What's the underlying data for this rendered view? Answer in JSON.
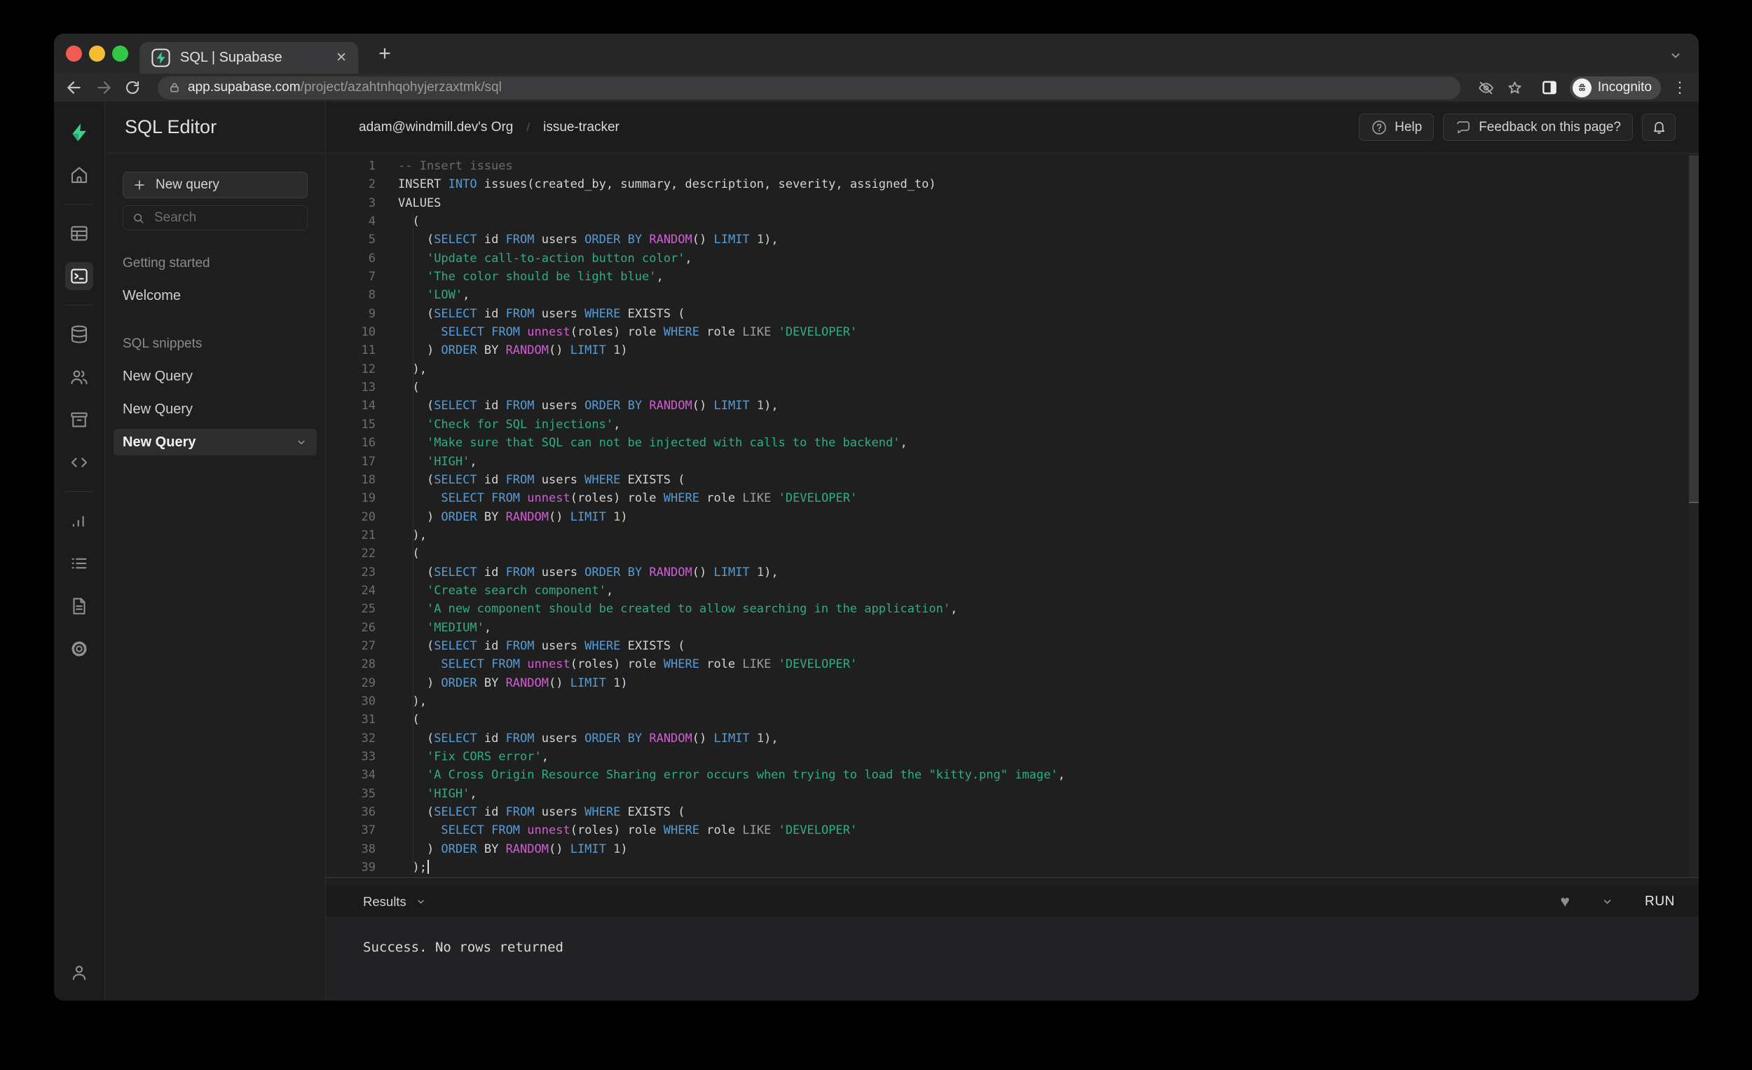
{
  "browser": {
    "tab_title": "SQL | Supabase",
    "url_host": "app.supabase.com",
    "url_path": "/project/azahtnhqohyjerzaxtmk/sql",
    "incognito_label": "Incognito"
  },
  "header": {
    "breadcrumb_org": "adam@windmill.dev's Org",
    "breadcrumb_sep": "/",
    "breadcrumb_project": "issue-tracker",
    "help_label": "Help",
    "feedback_label": "Feedback on this page?"
  },
  "sidebar": {
    "title": "SQL Editor",
    "new_query_button": "New query",
    "search_placeholder": "Search",
    "sections": [
      {
        "label": "Getting started",
        "items": [
          {
            "label": "Welcome"
          }
        ]
      },
      {
        "label": "SQL snippets",
        "items": [
          {
            "label": "New Query"
          },
          {
            "label": "New Query"
          },
          {
            "label": "New Query",
            "active": true
          }
        ]
      }
    ]
  },
  "results": {
    "label": "Results",
    "run_label": "RUN",
    "message": "Success. No rows returned"
  },
  "icons": {
    "plus": "+",
    "close": "✕",
    "kebab": "⋮",
    "heart": "♥",
    "question": "?"
  },
  "colors": {
    "accent_green": "#3ecf8e",
    "keyword_blue": "#569cd6",
    "function_magenta": "#d05ed0",
    "string_green": "#2fae7f",
    "number_green": "#b5cea8",
    "comment_gray": "#6b6b6b",
    "editor_bg": "#1f1f20",
    "chrome_bg": "#262627"
  },
  "editor": {
    "lines": [
      {
        "n": 1,
        "t": [
          [
            "c",
            "-- Insert issues"
          ]
        ]
      },
      {
        "n": 2,
        "t": [
          [
            "d",
            "INSERT "
          ],
          [
            "k",
            "INTO"
          ],
          [
            "d",
            " issues(created_by, summary, description, severity, assigned_to)"
          ]
        ]
      },
      {
        "n": 3,
        "t": [
          [
            "d",
            "VALUES"
          ]
        ]
      },
      {
        "n": 4,
        "t": [
          [
            "d",
            "  ("
          ]
        ]
      },
      {
        "n": 5,
        "t": [
          [
            "d",
            "    ("
          ],
          [
            "k",
            "SELECT"
          ],
          [
            "d",
            " id "
          ],
          [
            "k",
            "FROM"
          ],
          [
            "d",
            " users "
          ],
          [
            "k",
            "ORDER"
          ],
          [
            "d",
            " "
          ],
          [
            "k",
            "BY"
          ],
          [
            "d",
            " "
          ],
          [
            "f",
            "RANDOM"
          ],
          [
            "d",
            "() "
          ],
          [
            "k",
            "LIMIT"
          ],
          [
            "d",
            " "
          ],
          [
            "n",
            "1"
          ],
          [
            "d",
            "),"
          ]
        ]
      },
      {
        "n": 6,
        "t": [
          [
            "d",
            "    "
          ],
          [
            "s",
            "'Update call-to-action button color'"
          ],
          [
            "d",
            ","
          ]
        ]
      },
      {
        "n": 7,
        "t": [
          [
            "d",
            "    "
          ],
          [
            "s",
            "'The color should be light blue'"
          ],
          [
            "d",
            ","
          ]
        ]
      },
      {
        "n": 8,
        "t": [
          [
            "d",
            "    "
          ],
          [
            "s",
            "'LOW'"
          ],
          [
            "d",
            ","
          ]
        ]
      },
      {
        "n": 9,
        "t": [
          [
            "d",
            "    ("
          ],
          [
            "k",
            "SELECT"
          ],
          [
            "d",
            " id "
          ],
          [
            "k",
            "FROM"
          ],
          [
            "d",
            " users "
          ],
          [
            "k",
            "WHERE"
          ],
          [
            "d",
            " EXISTS ("
          ]
        ]
      },
      {
        "n": 10,
        "t": [
          [
            "d",
            "      "
          ],
          [
            "k",
            "SELECT"
          ],
          [
            "d",
            " "
          ],
          [
            "k",
            "FROM"
          ],
          [
            "d",
            " "
          ],
          [
            "f",
            "unnest"
          ],
          [
            "d",
            "(roles) role "
          ],
          [
            "k",
            "WHERE"
          ],
          [
            "d",
            " role "
          ],
          [
            "g",
            "LIKE"
          ],
          [
            "d",
            " "
          ],
          [
            "s",
            "'DEVELOPER'"
          ]
        ]
      },
      {
        "n": 11,
        "t": [
          [
            "d",
            "    ) "
          ],
          [
            "k",
            "ORDER"
          ],
          [
            "d",
            " BY "
          ],
          [
            "f",
            "RANDOM"
          ],
          [
            "d",
            "() "
          ],
          [
            "k",
            "LIMIT"
          ],
          [
            "d",
            " "
          ],
          [
            "n",
            "1"
          ],
          [
            "d",
            ")"
          ]
        ]
      },
      {
        "n": 12,
        "t": [
          [
            "d",
            "  ),"
          ]
        ]
      },
      {
        "n": 13,
        "t": [
          [
            "d",
            "  ("
          ]
        ]
      },
      {
        "n": 14,
        "t": [
          [
            "d",
            "    ("
          ],
          [
            "k",
            "SELECT"
          ],
          [
            "d",
            " id "
          ],
          [
            "k",
            "FROM"
          ],
          [
            "d",
            " users "
          ],
          [
            "k",
            "ORDER"
          ],
          [
            "d",
            " "
          ],
          [
            "k",
            "BY"
          ],
          [
            "d",
            " "
          ],
          [
            "f",
            "RANDOM"
          ],
          [
            "d",
            "() "
          ],
          [
            "k",
            "LIMIT"
          ],
          [
            "d",
            " "
          ],
          [
            "n",
            "1"
          ],
          [
            "d",
            "),"
          ]
        ]
      },
      {
        "n": 15,
        "t": [
          [
            "d",
            "    "
          ],
          [
            "s",
            "'Check for SQL injections'"
          ],
          [
            "d",
            ","
          ]
        ]
      },
      {
        "n": 16,
        "t": [
          [
            "d",
            "    "
          ],
          [
            "s",
            "'Make sure that SQL can not be injected with calls to the backend'"
          ],
          [
            "d",
            ","
          ]
        ]
      },
      {
        "n": 17,
        "t": [
          [
            "d",
            "    "
          ],
          [
            "s",
            "'HIGH'"
          ],
          [
            "d",
            ","
          ]
        ]
      },
      {
        "n": 18,
        "t": [
          [
            "d",
            "    ("
          ],
          [
            "k",
            "SELECT"
          ],
          [
            "d",
            " id "
          ],
          [
            "k",
            "FROM"
          ],
          [
            "d",
            " users "
          ],
          [
            "k",
            "WHERE"
          ],
          [
            "d",
            " EXISTS ("
          ]
        ]
      },
      {
        "n": 19,
        "t": [
          [
            "d",
            "      "
          ],
          [
            "k",
            "SELECT"
          ],
          [
            "d",
            " "
          ],
          [
            "k",
            "FROM"
          ],
          [
            "d",
            " "
          ],
          [
            "f",
            "unnest"
          ],
          [
            "d",
            "(roles) role "
          ],
          [
            "k",
            "WHERE"
          ],
          [
            "d",
            " role "
          ],
          [
            "g",
            "LIKE"
          ],
          [
            "d",
            " "
          ],
          [
            "s",
            "'DEVELOPER'"
          ]
        ]
      },
      {
        "n": 20,
        "t": [
          [
            "d",
            "    ) "
          ],
          [
            "k",
            "ORDER"
          ],
          [
            "d",
            " BY "
          ],
          [
            "f",
            "RANDOM"
          ],
          [
            "d",
            "() "
          ],
          [
            "k",
            "LIMIT"
          ],
          [
            "d",
            " "
          ],
          [
            "n",
            "1"
          ],
          [
            "d",
            ")"
          ]
        ]
      },
      {
        "n": 21,
        "t": [
          [
            "d",
            "  ),"
          ]
        ]
      },
      {
        "n": 22,
        "t": [
          [
            "d",
            "  ("
          ]
        ]
      },
      {
        "n": 23,
        "t": [
          [
            "d",
            "    ("
          ],
          [
            "k",
            "SELECT"
          ],
          [
            "d",
            " id "
          ],
          [
            "k",
            "FROM"
          ],
          [
            "d",
            " users "
          ],
          [
            "k",
            "ORDER"
          ],
          [
            "d",
            " "
          ],
          [
            "k",
            "BY"
          ],
          [
            "d",
            " "
          ],
          [
            "f",
            "RANDOM"
          ],
          [
            "d",
            "() "
          ],
          [
            "k",
            "LIMIT"
          ],
          [
            "d",
            " "
          ],
          [
            "n",
            "1"
          ],
          [
            "d",
            "),"
          ]
        ]
      },
      {
        "n": 24,
        "t": [
          [
            "d",
            "    "
          ],
          [
            "s",
            "'Create search component'"
          ],
          [
            "d",
            ","
          ]
        ]
      },
      {
        "n": 25,
        "t": [
          [
            "d",
            "    "
          ],
          [
            "s",
            "'A new component should be created to allow searching in the application'"
          ],
          [
            "d",
            ","
          ]
        ]
      },
      {
        "n": 26,
        "t": [
          [
            "d",
            "    "
          ],
          [
            "s",
            "'MEDIUM'"
          ],
          [
            "d",
            ","
          ]
        ]
      },
      {
        "n": 27,
        "t": [
          [
            "d",
            "    ("
          ],
          [
            "k",
            "SELECT"
          ],
          [
            "d",
            " id "
          ],
          [
            "k",
            "FROM"
          ],
          [
            "d",
            " users "
          ],
          [
            "k",
            "WHERE"
          ],
          [
            "d",
            " EXISTS ("
          ]
        ]
      },
      {
        "n": 28,
        "t": [
          [
            "d",
            "      "
          ],
          [
            "k",
            "SELECT"
          ],
          [
            "d",
            " "
          ],
          [
            "k",
            "FROM"
          ],
          [
            "d",
            " "
          ],
          [
            "f",
            "unnest"
          ],
          [
            "d",
            "(roles) role "
          ],
          [
            "k",
            "WHERE"
          ],
          [
            "d",
            " role "
          ],
          [
            "g",
            "LIKE"
          ],
          [
            "d",
            " "
          ],
          [
            "s",
            "'DEVELOPER'"
          ]
        ]
      },
      {
        "n": 29,
        "t": [
          [
            "d",
            "    ) "
          ],
          [
            "k",
            "ORDER"
          ],
          [
            "d",
            " BY "
          ],
          [
            "f",
            "RANDOM"
          ],
          [
            "d",
            "() "
          ],
          [
            "k",
            "LIMIT"
          ],
          [
            "d",
            " "
          ],
          [
            "n",
            "1"
          ],
          [
            "d",
            ")"
          ]
        ]
      },
      {
        "n": 30,
        "t": [
          [
            "d",
            "  ),"
          ]
        ]
      },
      {
        "n": 31,
        "t": [
          [
            "d",
            "  ("
          ]
        ]
      },
      {
        "n": 32,
        "t": [
          [
            "d",
            "    ("
          ],
          [
            "k",
            "SELECT"
          ],
          [
            "d",
            " id "
          ],
          [
            "k",
            "FROM"
          ],
          [
            "d",
            " users "
          ],
          [
            "k",
            "ORDER"
          ],
          [
            "d",
            " "
          ],
          [
            "k",
            "BY"
          ],
          [
            "d",
            " "
          ],
          [
            "f",
            "RANDOM"
          ],
          [
            "d",
            "() "
          ],
          [
            "k",
            "LIMIT"
          ],
          [
            "d",
            " "
          ],
          [
            "n",
            "1"
          ],
          [
            "d",
            "),"
          ]
        ]
      },
      {
        "n": 33,
        "t": [
          [
            "d",
            "    "
          ],
          [
            "s",
            "'Fix CORS error'"
          ],
          [
            "d",
            ","
          ]
        ]
      },
      {
        "n": 34,
        "t": [
          [
            "d",
            "    "
          ],
          [
            "s",
            "'A Cross Origin Resource Sharing error occurs when trying to load the \"kitty.png\" image'"
          ],
          [
            "d",
            ","
          ]
        ]
      },
      {
        "n": 35,
        "t": [
          [
            "d",
            "    "
          ],
          [
            "s",
            "'HIGH'"
          ],
          [
            "d",
            ","
          ]
        ]
      },
      {
        "n": 36,
        "t": [
          [
            "d",
            "    ("
          ],
          [
            "k",
            "SELECT"
          ],
          [
            "d",
            " id "
          ],
          [
            "k",
            "FROM"
          ],
          [
            "d",
            " users "
          ],
          [
            "k",
            "WHERE"
          ],
          [
            "d",
            " EXISTS ("
          ]
        ]
      },
      {
        "n": 37,
        "t": [
          [
            "d",
            "      "
          ],
          [
            "k",
            "SELECT"
          ],
          [
            "d",
            " "
          ],
          [
            "k",
            "FROM"
          ],
          [
            "d",
            " "
          ],
          [
            "f",
            "unnest"
          ],
          [
            "d",
            "(roles) role "
          ],
          [
            "k",
            "WHERE"
          ],
          [
            "d",
            " role "
          ],
          [
            "g",
            "LIKE"
          ],
          [
            "d",
            " "
          ],
          [
            "s",
            "'DEVELOPER'"
          ]
        ]
      },
      {
        "n": 38,
        "t": [
          [
            "d",
            "    ) "
          ],
          [
            "k",
            "ORDER"
          ],
          [
            "d",
            " BY "
          ],
          [
            "f",
            "RANDOM"
          ],
          [
            "d",
            "() "
          ],
          [
            "k",
            "LIMIT"
          ],
          [
            "d",
            " "
          ],
          [
            "n",
            "1"
          ],
          [
            "d",
            ")"
          ]
        ]
      },
      {
        "n": 39,
        "t": [
          [
            "d",
            "  );"
          ],
          [
            "caret",
            ""
          ]
        ]
      }
    ]
  }
}
